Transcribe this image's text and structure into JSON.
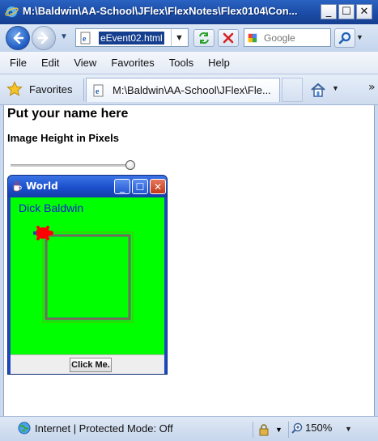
{
  "window": {
    "title": "M:\\Baldwin\\AA-School\\JFlex\\FlexNotes\\Flex0104\\Con...",
    "minimize": "_",
    "maximize": "☐",
    "close": "✕"
  },
  "address_bar": {
    "url": "eEvent02.html",
    "search_placeholder": "Google"
  },
  "menu": {
    "items": [
      "File",
      "Edit",
      "View",
      "Favorites",
      "Tools",
      "Help"
    ]
  },
  "favorites_bar": {
    "favorites_label": "Favorites",
    "tab_title": "M:\\Baldwin\\AA-School\\JFlex\\Fle...",
    "overflow": "»"
  },
  "page": {
    "heading": "Put your name here",
    "label": "Image Height in Pixels",
    "slider_value_fraction": 1.0
  },
  "java_frame": {
    "title": "World",
    "turtle_name": "Dick Baldwin",
    "button_label": "Click Me.",
    "colors": {
      "world": "#00ff00",
      "turtle": "#ff0000",
      "pen": "#b5651d",
      "name": "#1a1ad6"
    }
  },
  "status_bar": {
    "zone": "Internet | Protected Mode: Off",
    "zoom": "150%"
  },
  "icons": [
    "ie-logo-icon",
    "back-arrow-icon",
    "forward-arrow-icon",
    "refresh-icon",
    "stop-icon",
    "google-icon",
    "search-icon",
    "star-icon",
    "home-icon",
    "globe-icon",
    "lock-icon",
    "zoom-icon",
    "java-cup-icon"
  ]
}
